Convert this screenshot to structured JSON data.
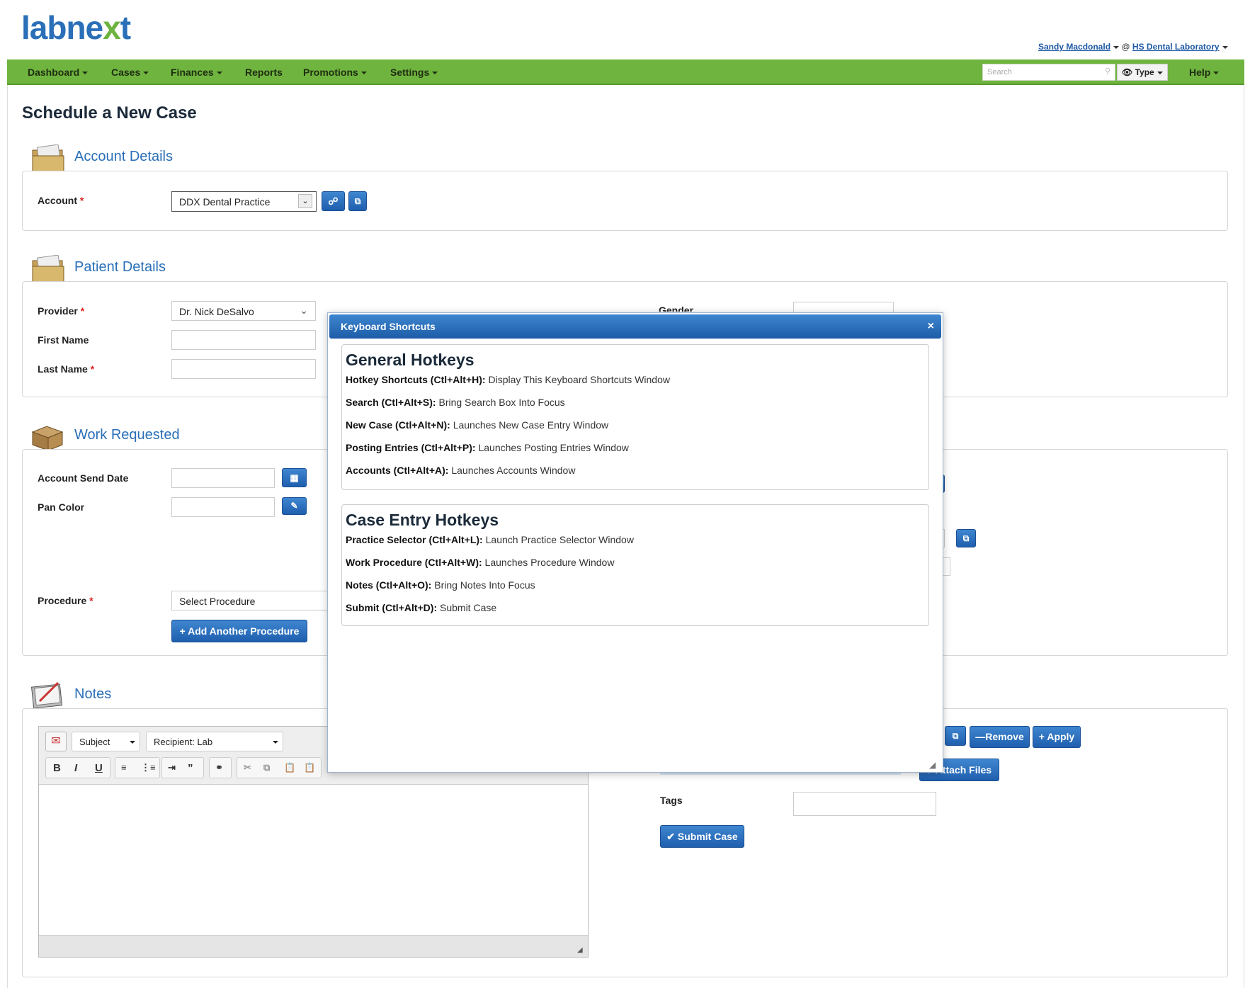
{
  "brand": {
    "logo_main": "labne",
    "logo_accent": "x",
    "logo_tail": "t"
  },
  "user": {
    "name": "Sandy Macdonald",
    "separator": "@",
    "lab": "HS Dental Laboratory"
  },
  "nav": {
    "items": [
      "Dashboard",
      "Cases",
      "Finances",
      "Reports",
      "Promotions",
      "Settings"
    ],
    "search_placeholder": "Search",
    "type_label": "Type",
    "help_label": "Help"
  },
  "page": {
    "title": "Schedule a New Case"
  },
  "account_section": {
    "title": "Account Details",
    "account_label": "Account",
    "account_value": "DDX Dental Practice"
  },
  "patient_section": {
    "title": "Patient Details",
    "provider_label": "Provider",
    "provider_value": "Dr. Nick DeSalvo",
    "first_name_label": "First Name",
    "last_name_label": "Last Name",
    "gender_label": "Gender"
  },
  "work_section": {
    "title": "Work Requested",
    "send_date_label": "Account Send Date",
    "pan_color_label": "Pan Color",
    "procedure_label": "Procedure",
    "procedure_value": "Select Procedure",
    "add_procedure_label": "+ Add Another Procedure"
  },
  "notes_section": {
    "title": "Notes",
    "subject_value": "Subject",
    "recipient_value": "Recipient: Lab",
    "remove_label": "Remove",
    "apply_label": "Apply",
    "attach_label": "Attach Files",
    "tags_label": "Tags",
    "submit_label": "Submit Case"
  },
  "modal": {
    "title": "Keyboard Shortcuts",
    "close": "×",
    "groups": [
      {
        "title": "General Hotkeys",
        "items": [
          {
            "key": "Hotkey Shortcuts (Ctl+Alt+H):",
            "desc": "Display This Keyboard Shortcuts Window"
          },
          {
            "key": "Search (Ctl+Alt+S):",
            "desc": "Bring Search Box Into Focus"
          },
          {
            "key": "New Case (Ctl+Alt+N):",
            "desc": "Launches New Case Entry Window"
          },
          {
            "key": "Posting Entries (Ctl+Alt+P):",
            "desc": "Launches Posting Entries Window"
          },
          {
            "key": "Accounts (Ctl+Alt+A):",
            "desc": "Launches Accounts Window"
          }
        ]
      },
      {
        "title": "Case Entry Hotkeys",
        "items": [
          {
            "key": "Practice Selector (Ctl+Alt+L):",
            "desc": "Launch Practice Selector Window"
          },
          {
            "key": "Work Procedure (Ctl+Alt+W):",
            "desc": "Launches Procedure Window"
          },
          {
            "key": "Notes (Ctl+Alt+O):",
            "desc": "Bring Notes Into Focus"
          },
          {
            "key": "Submit (Ctl+Alt+D):",
            "desc": "Submit Case"
          }
        ]
      }
    ]
  }
}
